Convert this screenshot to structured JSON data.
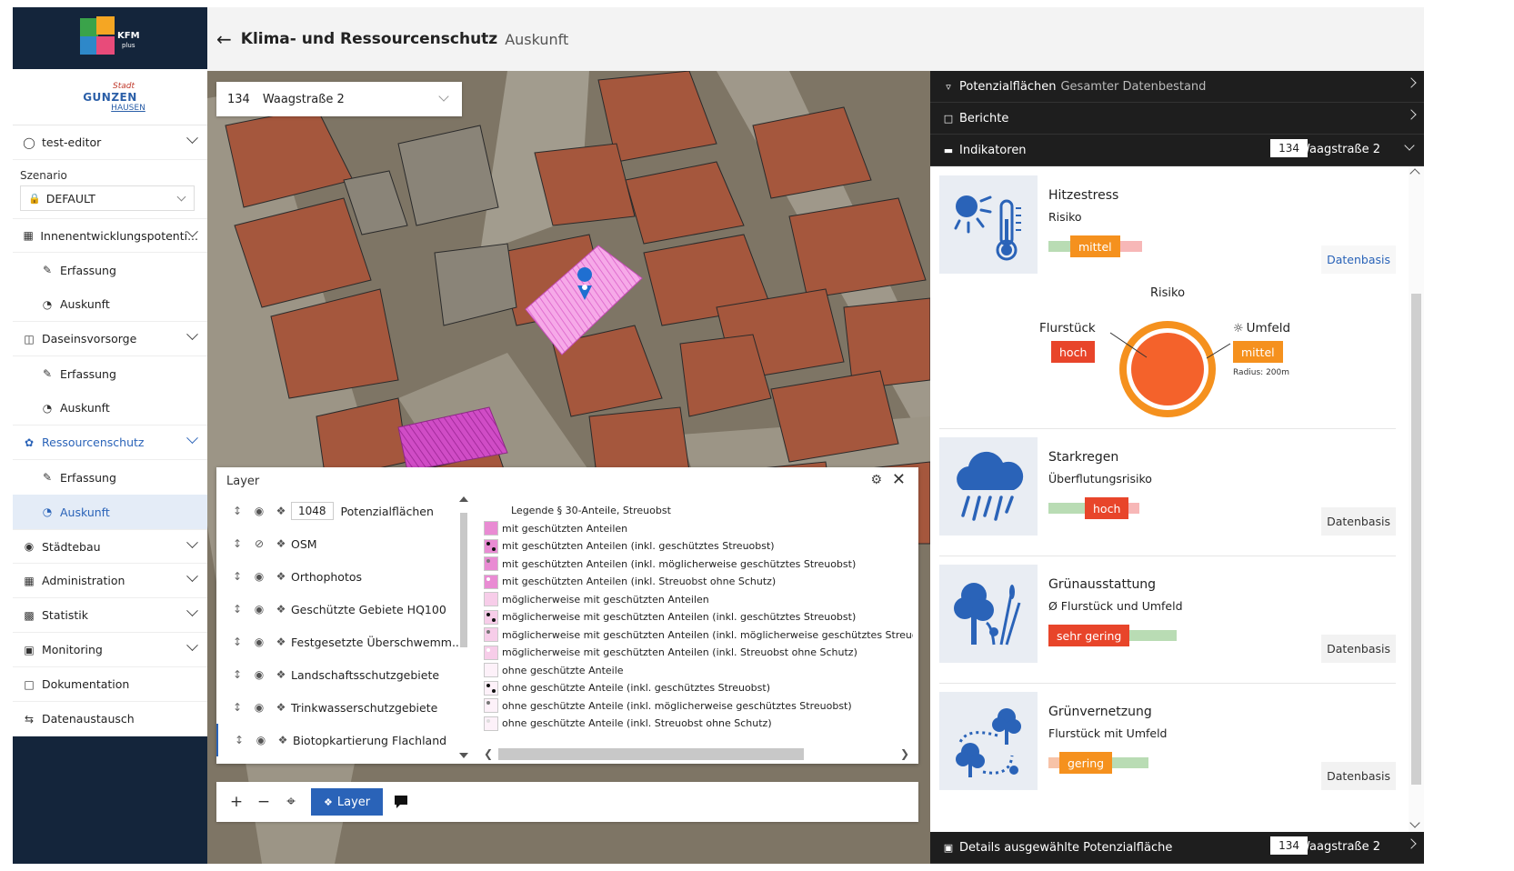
{
  "app": {
    "logo_text": "KFM",
    "logo_sub": "plus"
  },
  "city": {
    "l1": "Stadt",
    "l2": "GUNZEN",
    "l3": "HAUSEN"
  },
  "user": {
    "name": "test-editor"
  },
  "scenario": {
    "label": "Szenario",
    "value": "DEFAULT"
  },
  "nav": {
    "innen": "Innenentwicklungspotenti...",
    "innen_erf": "Erfassung",
    "innen_aus": "Auskunft",
    "dasein": "Daseinsvorsorge",
    "dasein_erf": "Erfassung",
    "dasein_aus": "Auskunft",
    "ress": "Ressourcenschutz",
    "ress_erf": "Erfassung",
    "ress_aus": "Auskunft",
    "staedtebau": "Städtebau",
    "admin": "Administration",
    "statistik": "Statistik",
    "monitoring": "Monitoring",
    "doku": "Dokumentation",
    "daten": "Datenaustausch"
  },
  "header": {
    "back": "←",
    "title": "Klima- und Ressourcenschutz",
    "subtitle": "Auskunft"
  },
  "address": {
    "num": "134",
    "street": "Waagstraße 2"
  },
  "layerpanel": {
    "title": "Layer",
    "rows": [
      {
        "badge": "1048",
        "name": "Potenzialflächen"
      },
      {
        "name": "OSM"
      },
      {
        "name": "Orthophotos"
      },
      {
        "name": "Geschützte Gebiete HQ100"
      },
      {
        "name": "Festgesetzte Überschwemm..."
      },
      {
        "name": "Landschaftsschutzgebiete"
      },
      {
        "name": "Trinkwasserschutzgebiete"
      },
      {
        "name": "Biotopkartierung Flachland"
      }
    ],
    "legend_title": "Legende § 30-Anteile, Streuobst",
    "legend": [
      "mit geschützten Anteilen",
      "mit geschützten Anteilen (inkl. geschütztes Streuobst)",
      "mit geschützten Anteilen (inkl. möglicherweise geschütztes Streuobst)",
      "mit geschützten Anteilen (inkl. Streuobst ohne Schutz)",
      "möglicherweise mit geschützten Anteilen",
      "möglicherweise mit geschützten Anteilen (inkl. geschütztes Streuobst)",
      "möglicherweise mit geschützten Anteilen (inkl. möglicherweise geschütztes Streuobst",
      "möglicherweise mit geschützten Anteilen (inkl. Streuobst ohne Schutz)",
      "ohne geschützte Anteile",
      "ohne geschützte Anteile (inkl. geschütztes Streuobst)",
      "ohne geschützte Anteile (inkl. möglicherweise geschütztes Streuobst)",
      "ohne geschützte Anteile (inkl. Streuobst ohne Schutz)"
    ]
  },
  "tools": {
    "plus": "+",
    "minus": "−",
    "layer_btn": "Layer"
  },
  "right": {
    "acc1_title": "Potenzialflächen",
    "acc1_sub": "Gesamter Datenbestand",
    "acc2_title": "Berichte",
    "acc3_title": "Indikatoren",
    "acc3_num": "134",
    "acc3_street": "Waagstraße 2",
    "foot_title": "Details ausgewählte Potenzialfläche",
    "foot_num": "134",
    "foot_street": "Waagstraße 2"
  },
  "indicators": {
    "hitze": {
      "title": "Hitzestress",
      "sub": "Risiko",
      "level": "mittel",
      "db": "Datenbasis"
    },
    "risk": {
      "title": "Risiko",
      "left_label": "Flurstück",
      "left_level": "hoch",
      "right_label": "Umfeld",
      "right_level": "mittel",
      "radius": "Radius: 200m"
    },
    "regen": {
      "title": "Starkregen",
      "sub": "Überflutungsrisiko",
      "level": "hoch",
      "db": "Datenbasis"
    },
    "gruen": {
      "title": "Grünausstattung",
      "sub": "Ø Flurstück und Umfeld",
      "level": "sehr gering",
      "db": "Datenbasis"
    },
    "vernetz": {
      "title": "Grünvernetzung",
      "sub": "Flurstück mit Umfeld",
      "level": "gering",
      "db": "Datenbasis"
    }
  },
  "colors": {
    "accent": "#2a63b8",
    "dark": "#14253b",
    "panel": "#1e1e1e",
    "hoch": "#e8452a",
    "mittel": "#f5911e",
    "icon": "#2a63b8"
  }
}
